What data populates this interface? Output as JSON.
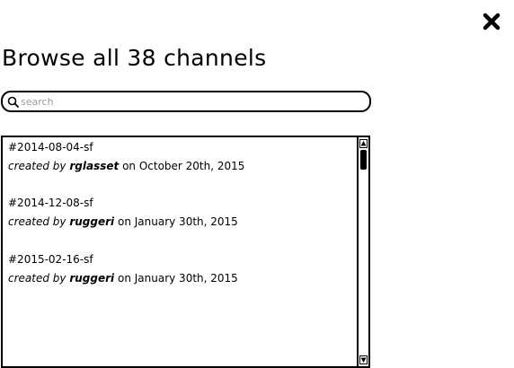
{
  "dialog": {
    "title": "Browse all 38 channels",
    "close_icon": "close-icon"
  },
  "search": {
    "placeholder": "search",
    "value": "",
    "icon": "search-icon"
  },
  "channels": [
    {
      "name": "#2014-08-04-sf",
      "created_by_label": "created by",
      "author": "rglasset",
      "date_text": "on October 20th, 2015"
    },
    {
      "name": "#2014-12-08-sf",
      "created_by_label": "created by",
      "author": "ruggeri",
      "date_text": "on January 30th, 2015"
    },
    {
      "name": "#2015-02-16-sf",
      "created_by_label": "created by",
      "author": "ruggeri",
      "date_text": "on January 30th, 2015"
    }
  ],
  "scrollbar": {
    "up_icon": "scroll-up-arrow-icon",
    "down_icon": "scroll-down-arrow-icon"
  }
}
